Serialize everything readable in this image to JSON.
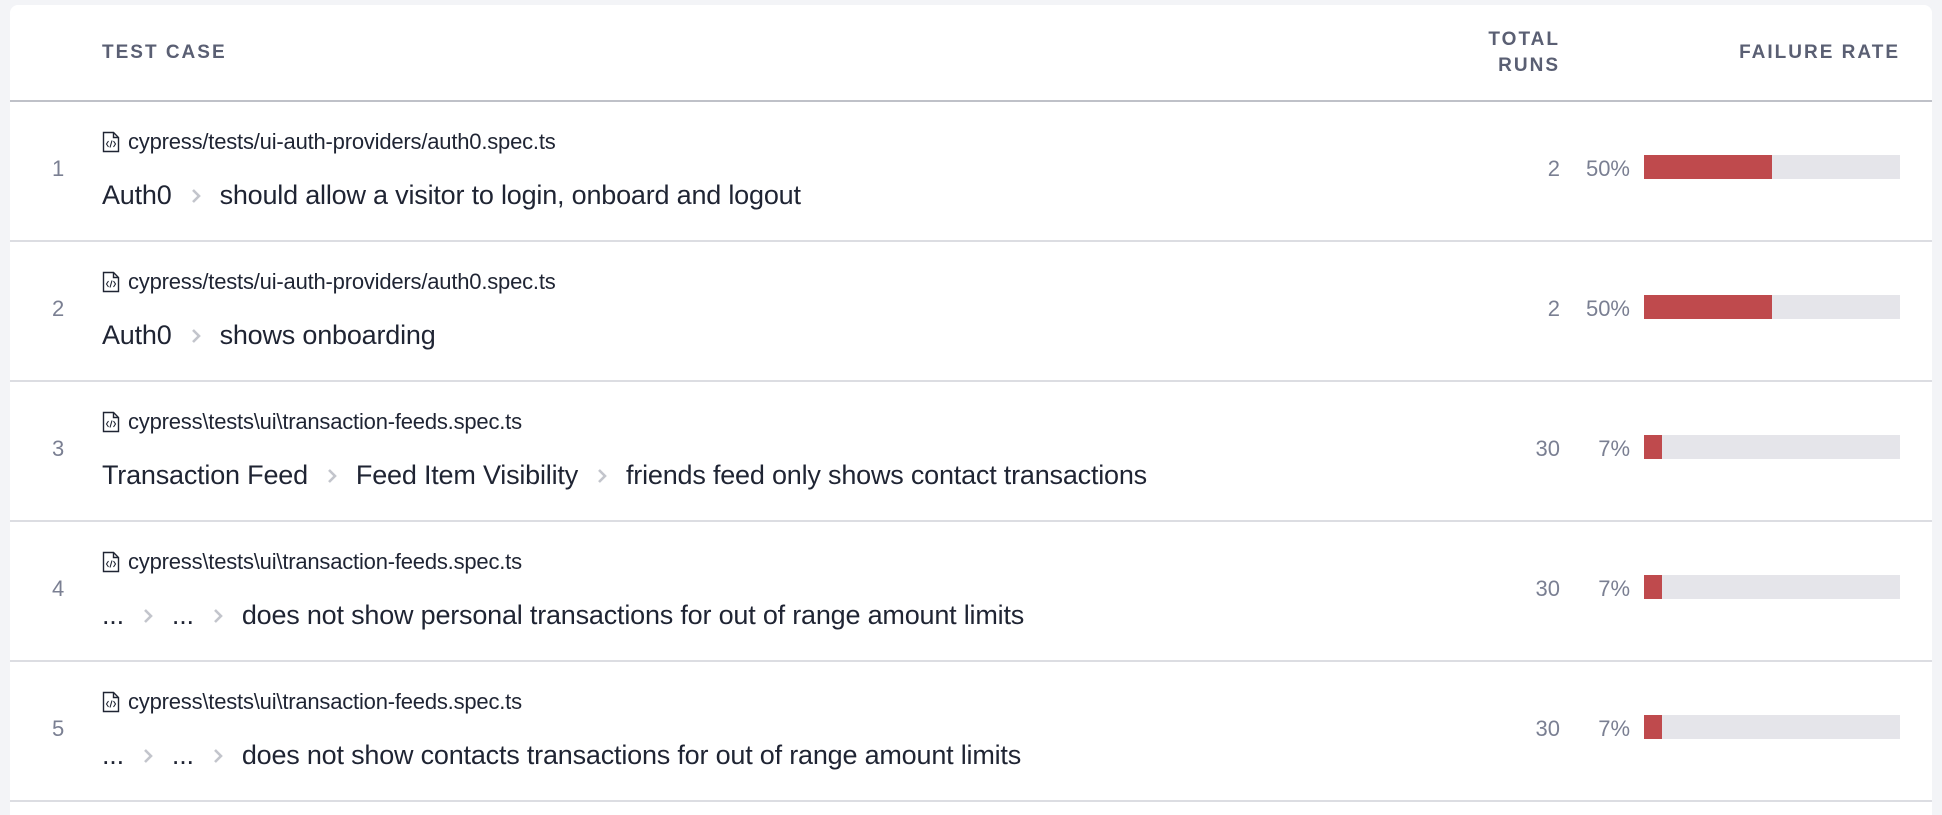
{
  "table": {
    "columns": {
      "test_case": "Test Case",
      "total_runs": "Total Runs",
      "failure_rate": "Failure Rate"
    },
    "colors": {
      "failure_fill": "#bf4a4d",
      "bar_track": "#e5e5ea"
    },
    "rows": [
      {
        "index": "1",
        "file_icon": "code-file-icon",
        "file": "cypress/tests/ui-auth-providers/auth0.spec.ts",
        "crumbs": [
          "Auth0",
          "should allow a visitor to login, onboard and logout"
        ],
        "total_runs": "2",
        "failure_rate_label": "50%",
        "failure_rate": 0.5
      },
      {
        "index": "2",
        "file_icon": "code-file-icon",
        "file": "cypress/tests/ui-auth-providers/auth0.spec.ts",
        "crumbs": [
          "Auth0",
          "shows onboarding"
        ],
        "total_runs": "2",
        "failure_rate_label": "50%",
        "failure_rate": 0.5
      },
      {
        "index": "3",
        "file_icon": "code-file-icon",
        "file": "cypress\\tests\\ui\\transaction-feeds.spec.ts",
        "crumbs": [
          "Transaction Feed",
          "Feed Item Visibility",
          "friends feed only shows contact transactions"
        ],
        "total_runs": "30",
        "failure_rate_label": "7%",
        "failure_rate": 0.07
      },
      {
        "index": "4",
        "file_icon": "code-file-icon",
        "file": "cypress\\tests\\ui\\transaction-feeds.spec.ts",
        "crumbs": [
          "...",
          "...",
          "does not show personal transactions for out of range amount limits"
        ],
        "total_runs": "30",
        "failure_rate_label": "7%",
        "failure_rate": 0.07
      },
      {
        "index": "5",
        "file_icon": "code-file-icon",
        "file": "cypress\\tests\\ui\\transaction-feeds.spec.ts",
        "crumbs": [
          "...",
          "...",
          "does not show contacts transactions for out of range amount limits"
        ],
        "total_runs": "30",
        "failure_rate_label": "7%",
        "failure_rate": 0.07
      }
    ]
  }
}
